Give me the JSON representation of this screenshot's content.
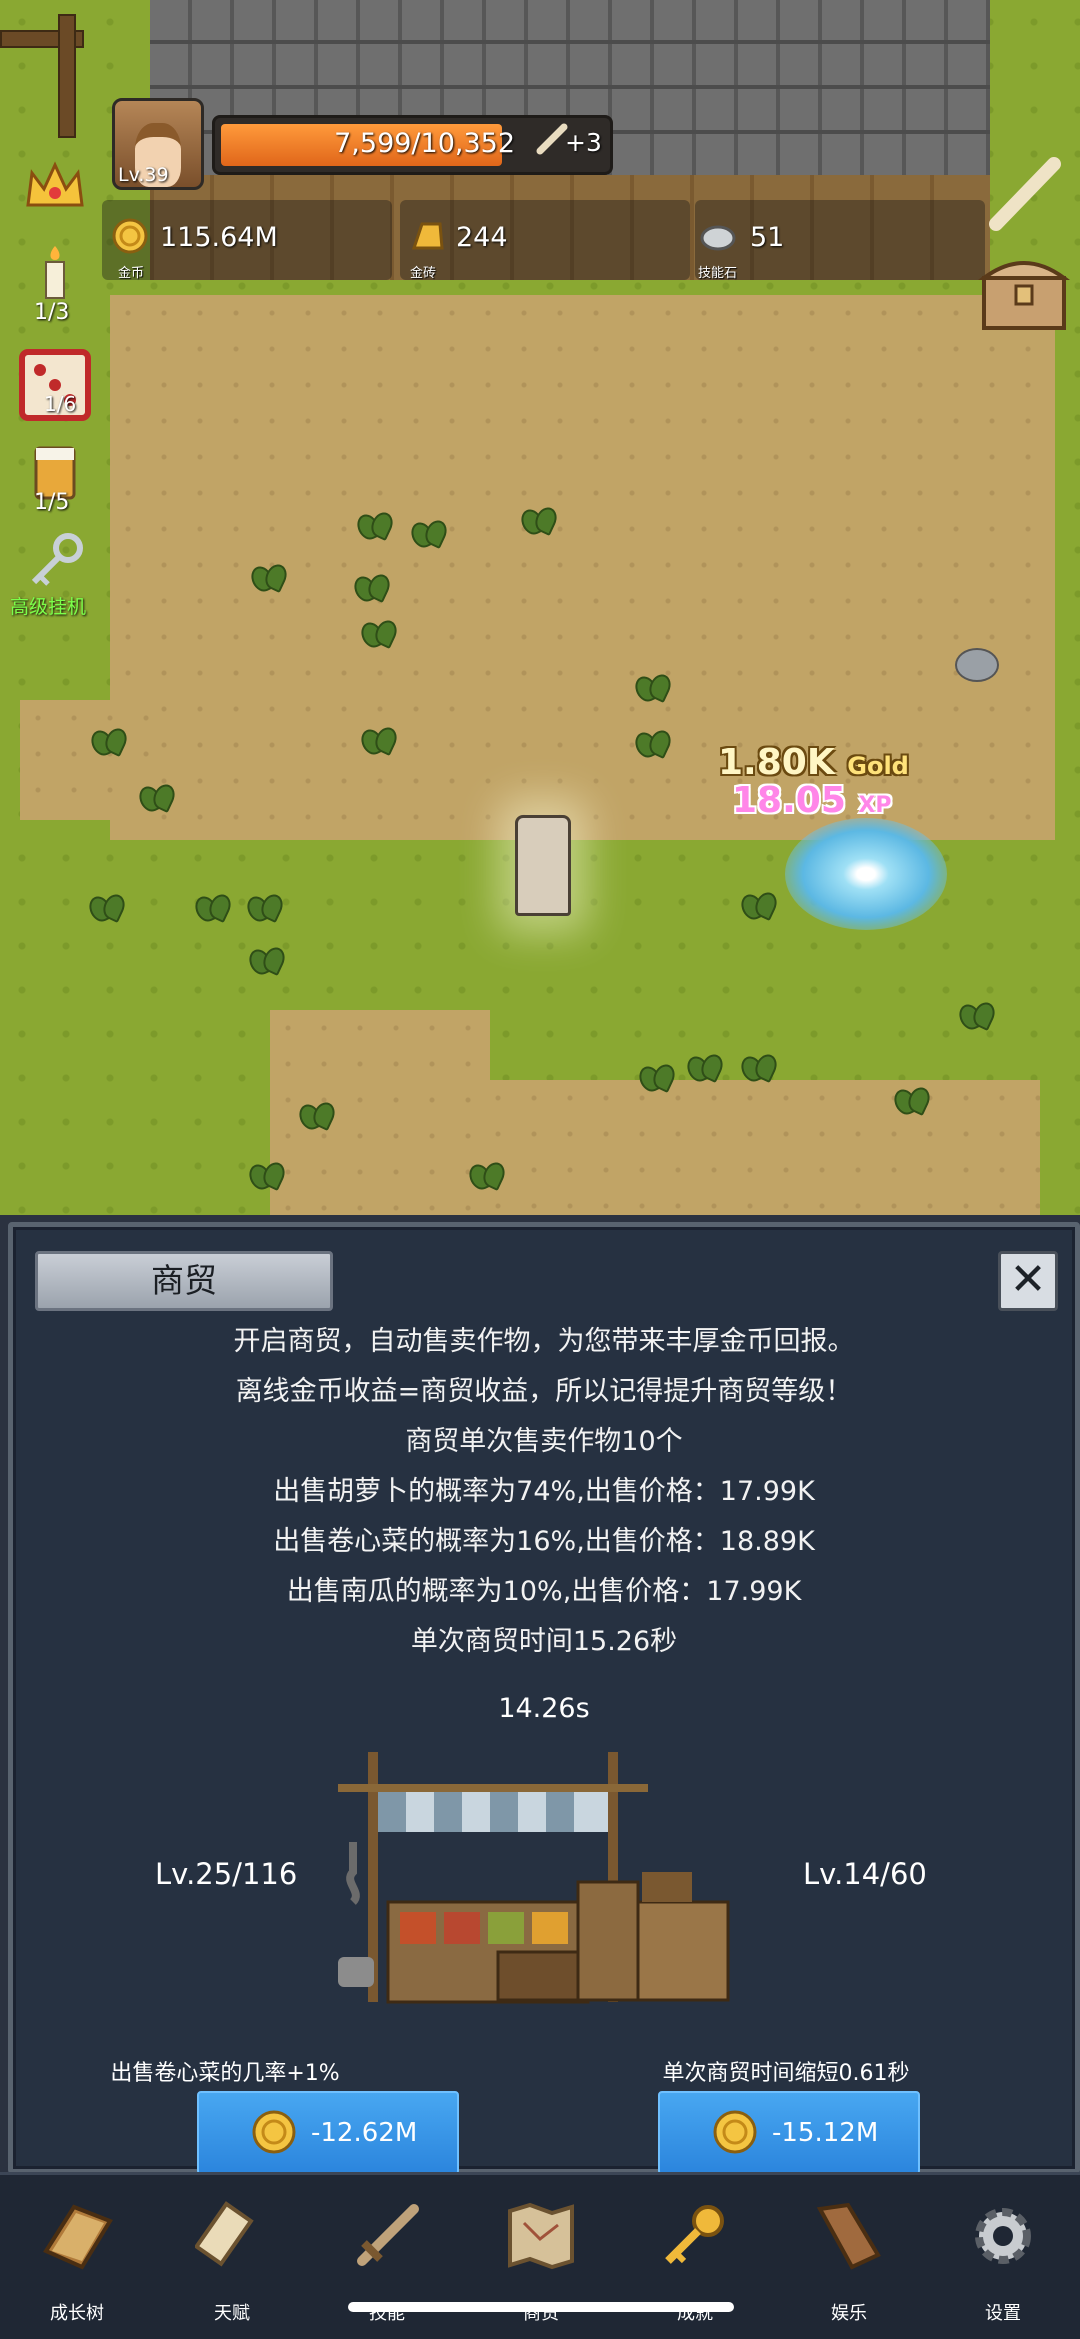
{
  "hud": {
    "level": "Lv.39",
    "xp_text": "7,599/10,352",
    "xp_fraction": 0.734,
    "xp_bonus": "+3",
    "resources": [
      {
        "icon": "gold-coin-icon",
        "value": "115.64M",
        "label": "金币"
      },
      {
        "icon": "gold-brick-icon",
        "value": "244",
        "label": "金砖"
      },
      {
        "icon": "skill-stone-icon",
        "value": "51",
        "label": "技能石"
      }
    ],
    "left_counters": {
      "candle": "1/3",
      "dice": "1/6",
      "beer": "1/5",
      "idle_label": "高级挂机"
    }
  },
  "field": {
    "gold_popup": "1.80K",
    "gold_unit": "Gold",
    "xp_popup": "18.05",
    "xp_unit": "XP"
  },
  "panel": {
    "title": "商贸",
    "close": "✕",
    "desc_lines": [
      "开启商贸，自动售卖作物，为您带来丰厚金币回报。",
      "离线金币收益=商贸收益，所以记得提升商贸等级！",
      "商贸单次售卖作物10个",
      "出售胡萝卜的概率为74%,出售价格：17.99K",
      "出售卷心菜的概率为16%,出售价格：18.89K",
      "出售南瓜的概率为10%,出售价格：17.99K",
      "单次商贸时间15.26秒"
    ],
    "timer": "14.26s",
    "left_level": "Lv.25/116",
    "right_level": "Lv.14/60",
    "left_upgrade_label": "出售卷心菜的几率+1%",
    "left_upgrade_cost": "-12.62M",
    "right_upgrade_label": "单次商贸时间缩短0.61秒",
    "right_upgrade_cost": "-15.12M"
  },
  "nav": {
    "items": [
      {
        "icon": "book-icon",
        "label": "成长树"
      },
      {
        "icon": "scroll-icon",
        "label": "天赋"
      },
      {
        "icon": "sword-icon",
        "label": "技能"
      },
      {
        "icon": "map-icon",
        "label": "商贸"
      },
      {
        "icon": "key-icon",
        "label": "成就"
      },
      {
        "icon": "horn-icon",
        "label": "娱乐"
      },
      {
        "icon": "gear-icon",
        "label": "设置"
      }
    ]
  },
  "colors": {
    "panel_bg": "#263141",
    "button_blue": "#2b85dd",
    "xp_orange": "#e0661a"
  }
}
